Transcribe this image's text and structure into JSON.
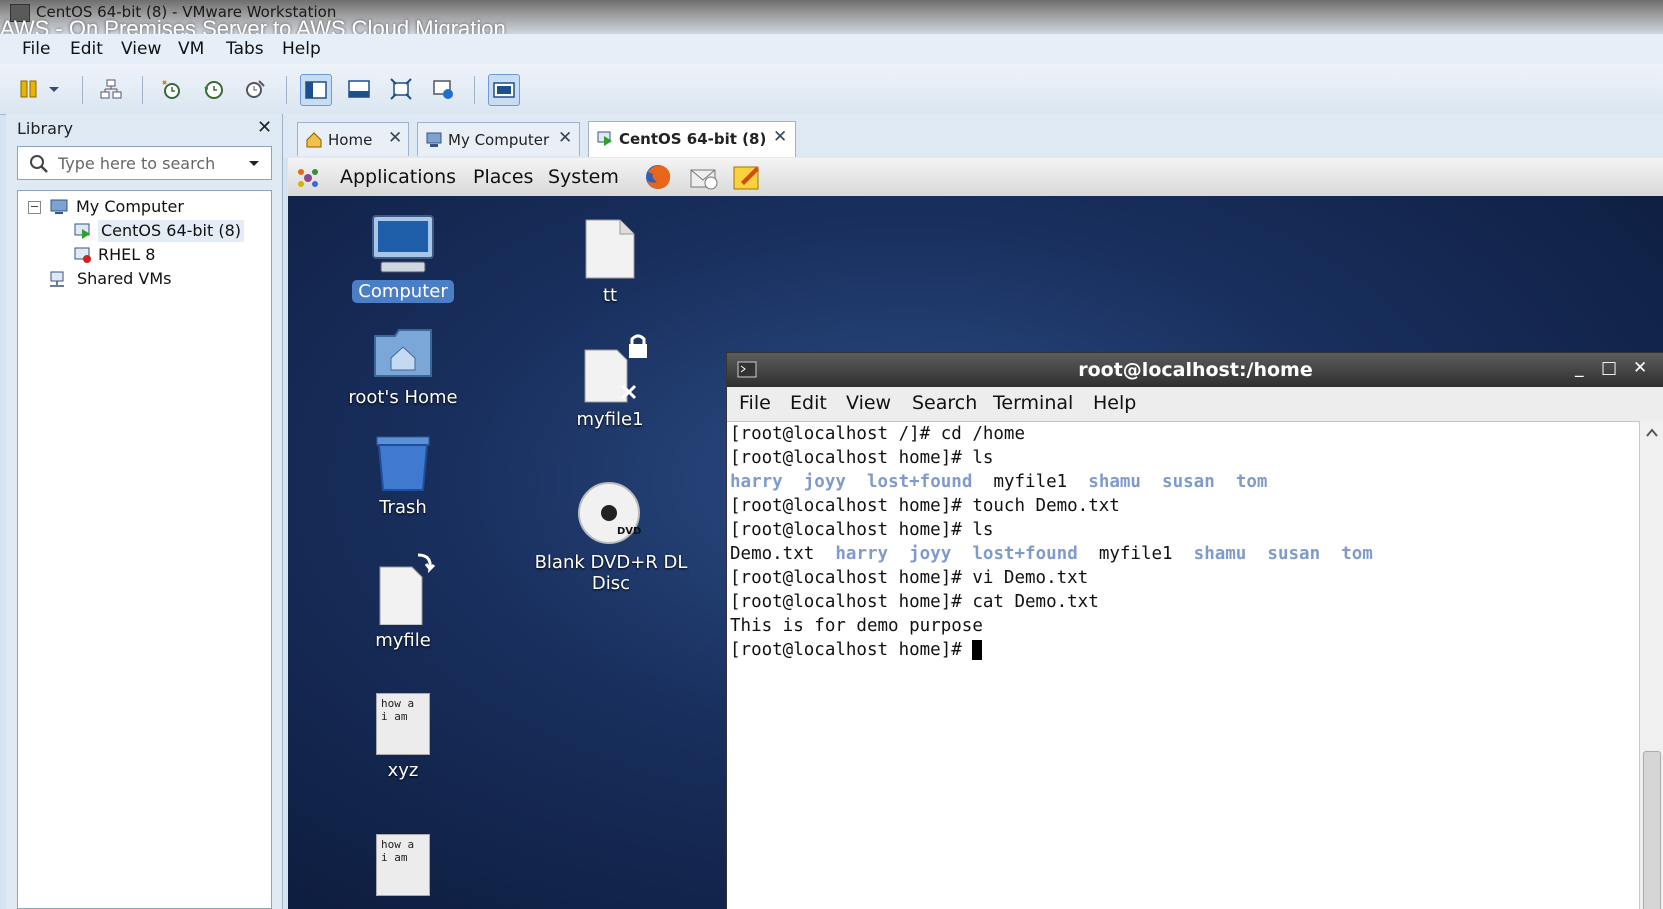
{
  "window": {
    "title": "CentOS 64-bit (8) - VMware Workstation",
    "video_title": "AWS - On Premises Server to AWS Cloud Migration"
  },
  "menubar": {
    "items": [
      "File",
      "Edit",
      "View",
      "VM",
      "Tabs",
      "Help"
    ]
  },
  "toolbar": {
    "buttons": [
      "pause-icon",
      "power-dropdown-icon",
      "send-ctrl-alt-del-icon",
      "snapshot-take-icon",
      "snapshot-revert-icon",
      "snapshot-manager-icon",
      "library-view-icon",
      "thumbnail-bar-icon",
      "fullscreen-icon",
      "unity-icon",
      "console-view-icon"
    ]
  },
  "library": {
    "title": "Library",
    "close": "✕",
    "search_placeholder": "Type here to search",
    "tree": {
      "root": "My Computer",
      "vm1": "CentOS 64-bit (8)",
      "vm2": "RHEL 8",
      "shared": "Shared VMs",
      "collapse": "−"
    }
  },
  "tabs": [
    {
      "label": "Home",
      "close": "✕"
    },
    {
      "label": "My Computer",
      "close": "✕"
    },
    {
      "label": "CentOS 64-bit (8)",
      "close": "✕"
    }
  ],
  "guest": {
    "panel": {
      "applications": "Applications",
      "places": "Places",
      "system": "System"
    },
    "desktop_icons": {
      "computer": "Computer",
      "home": "root's Home",
      "trash": "Trash",
      "myfile": "myfile",
      "xyz": "xyz",
      "tt": "tt",
      "myfile1": "myfile1",
      "dvd": "Blank DVD+R DL Disc",
      "doc_preview": "how a i am",
      "dvd_badge": "DVD"
    }
  },
  "terminal": {
    "title": "root@localhost:/home",
    "controls": {
      "minimize": "_",
      "maximize": "□",
      "close": "✕"
    },
    "menu": [
      "File",
      "Edit",
      "View",
      "Search",
      "Terminal",
      "Help"
    ],
    "lines": {
      "l1": "[root@localhost /]# cd /home",
      "l2": "[root@localhost home]# ls",
      "l3": {
        "harry": "harry",
        "joyy": "joyy",
        "lost": "lost+found",
        "myfile1": "myfile1",
        "shamu": "shamu",
        "susan": "susan",
        "tom": "tom"
      },
      "l4": "[root@localhost home]# touch Demo.txt",
      "l5": "[root@localhost home]# ls",
      "l6": {
        "demo": "Demo.txt",
        "harry": "harry",
        "joyy": "joyy",
        "lost": "lost+found",
        "myfile1": "myfile1",
        "shamu": "shamu",
        "susan": "susan",
        "tom": "tom"
      },
      "l7": "[root@localhost home]# vi Demo.txt",
      "l8": "[root@localhost home]# cat Demo.txt",
      "l9": "This is for demo purpose",
      "l10": "[root@localhost home]# "
    },
    "dir_color": "#7f9bcc"
  }
}
